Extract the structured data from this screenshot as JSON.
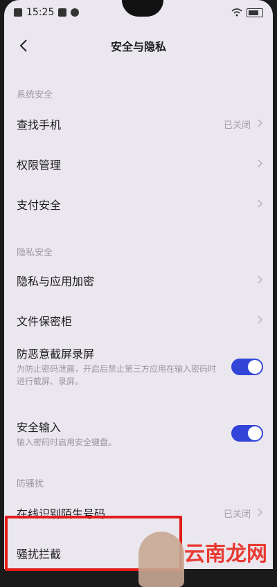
{
  "status_bar": {
    "time": "15:25"
  },
  "header": {
    "title": "安全与隐私"
  },
  "sections": {
    "system": {
      "label": "系统安全",
      "items": [
        {
          "label": "查找手机",
          "value": "已关闭"
        },
        {
          "label": "权限管理"
        },
        {
          "label": "支付安全"
        }
      ]
    },
    "privacy": {
      "label": "隐私安全",
      "items": [
        {
          "label": "隐私与应用加密"
        },
        {
          "label": "文件保密柜"
        },
        {
          "label": "防恶意截屏录屏",
          "desc": "为防止密码泄露，开启后禁止第三方应用在输入密码时进行截屏、录屏。",
          "toggle": "on"
        },
        {
          "label": "安全输入",
          "desc": "输入密码时启用安全键盘。",
          "toggle": "on"
        }
      ]
    },
    "harass": {
      "label": "防骚扰",
      "items": [
        {
          "label": "在线识别陌生号码",
          "value": "已关闭"
        },
        {
          "label": "骚扰拦截"
        }
      ]
    }
  },
  "colors": {
    "toggle_on": "#3345d8",
    "highlight": "#e21b1b"
  },
  "watermark": "云南龙网"
}
